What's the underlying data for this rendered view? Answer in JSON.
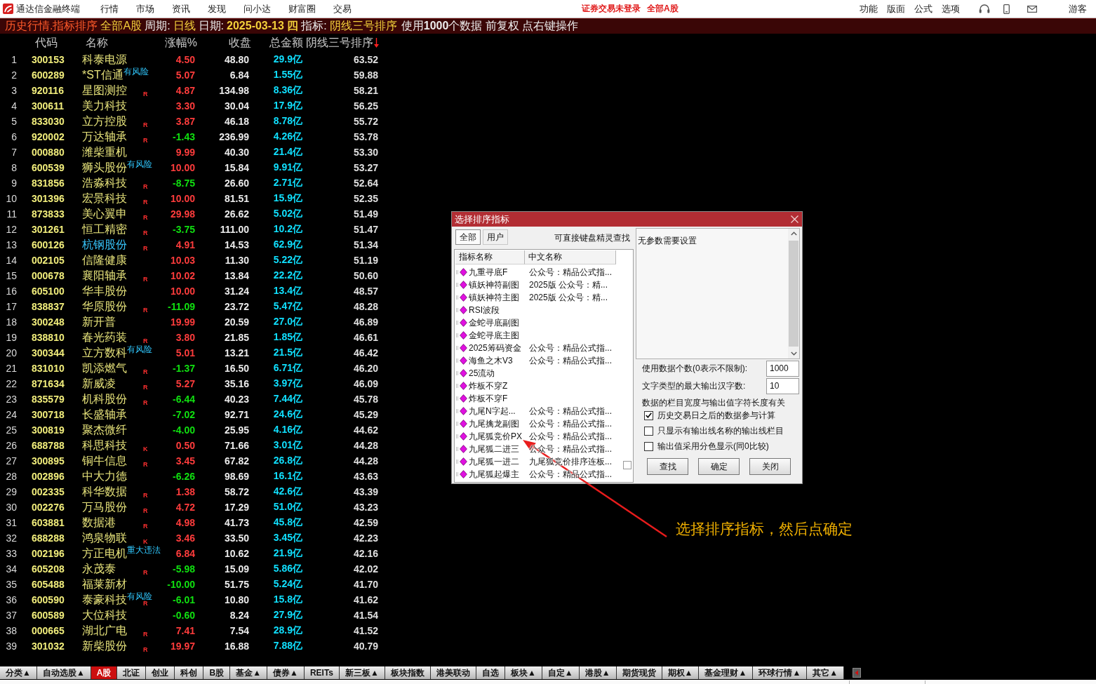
{
  "app_bar": {
    "title": "通达信金融终端",
    "menu": [
      "行情",
      "市场",
      "资讯",
      "发现",
      "问小达",
      "财富圈",
      "交易"
    ],
    "status": [
      "证券交易未登录",
      "全部A股"
    ],
    "tools": [
      "功能",
      "版面",
      "公式",
      "选项"
    ],
    "user": "游客"
  },
  "info_bar": [
    {
      "text": "历史行情.指标排序",
      "kind": "title"
    },
    {
      "text": "全部A股",
      "kind": "value"
    },
    {
      "text": "周期:",
      "kind": "label"
    },
    {
      "text": "日线",
      "kind": "value"
    },
    {
      "text": "日期:",
      "kind": "label"
    },
    {
      "text": "2025-03-13 四",
      "kind": "date"
    },
    {
      "text": "指标:",
      "kind": "label"
    },
    {
      "text": "阴线三号排序",
      "kind": "value"
    },
    {
      "text": "使用**1000**个数据 前复权 点右键操作",
      "kind": "label"
    }
  ],
  "table": {
    "columns": [
      {
        "label": "代码",
        "sorted": false
      },
      {
        "label": "名称",
        "sorted": false
      },
      {
        "label": "涨幅%",
        "sorted": false
      },
      {
        "label": "收盘",
        "sorted": false
      },
      {
        "label": "总金额",
        "sorted": false
      },
      {
        "label": "阴线三号排序",
        "sorted": true
      }
    ],
    "rows": [
      {
        "no": "1",
        "code": "300153",
        "name": "科泰电源",
        "change": "4.50",
        "rising": true,
        "close": "48.80",
        "amount": "29.9亿",
        "rank": "63.52",
        "highlighted": false
      },
      {
        "no": "2",
        "code": "600289",
        "name": "*ST信通",
        "note": "有风险",
        "change": "5.07",
        "rising": true,
        "close": "6.84",
        "amount": "1.55亿",
        "rank": "59.88",
        "highlighted": false
      },
      {
        "no": "3",
        "code": "920116",
        "name": "星图测控",
        "tag": "R",
        "change": "4.87",
        "rising": true,
        "close": "134.98",
        "amount": "8.36亿",
        "rank": "58.21",
        "highlighted": false
      },
      {
        "no": "4",
        "code": "300611",
        "name": "美力科技",
        "change": "3.30",
        "rising": true,
        "close": "30.04",
        "amount": "17.9亿",
        "rank": "56.25",
        "highlighted": false
      },
      {
        "no": "5",
        "code": "833030",
        "name": "立方控股",
        "tag": "R",
        "change": "3.87",
        "rising": true,
        "close": "46.18",
        "amount": "8.78亿",
        "rank": "55.72",
        "highlighted": false
      },
      {
        "no": "6",
        "code": "920002",
        "name": "万达轴承",
        "tag": "R",
        "change": "-1.43",
        "rising": false,
        "close": "236.99",
        "amount": "4.26亿",
        "rank": "53.78",
        "highlighted": false
      },
      {
        "no": "7",
        "code": "000880",
        "name": "潍柴重机",
        "change": "9.99",
        "rising": true,
        "close": "40.30",
        "amount": "21.4亿",
        "rank": "53.30",
        "highlighted": false
      },
      {
        "no": "8",
        "code": "600539",
        "name": "狮头股份",
        "note": "有风险",
        "change": "10.00",
        "rising": true,
        "close": "15.84",
        "amount": "9.91亿",
        "rank": "53.27",
        "highlighted": false
      },
      {
        "no": "9",
        "code": "831856",
        "name": "浩淼科技",
        "tag": "R",
        "change": "-8.75",
        "rising": false,
        "close": "26.60",
        "amount": "2.71亿",
        "rank": "52.64",
        "highlighted": false
      },
      {
        "no": "10",
        "code": "301396",
        "name": "宏景科技",
        "tag": "R",
        "change": "10.00",
        "rising": true,
        "close": "81.51",
        "amount": "15.9亿",
        "rank": "52.35",
        "highlighted": false
      },
      {
        "no": "11",
        "code": "873833",
        "name": "美心翼申",
        "tag": "R",
        "change": "29.98",
        "rising": true,
        "close": "26.62",
        "amount": "5.02亿",
        "rank": "51.49",
        "highlighted": false
      },
      {
        "no": "12",
        "code": "301261",
        "name": "恒工精密",
        "tag": "R",
        "change": "-3.75",
        "rising": false,
        "close": "111.00",
        "amount": "10.2亿",
        "rank": "51.47",
        "highlighted": false
      },
      {
        "no": "13",
        "code": "600126",
        "name": "杭钢股份",
        "tag": "R",
        "change": "4.91",
        "rising": true,
        "close": "14.53",
        "amount": "62.9亿",
        "rank": "51.34",
        "highlighted": true
      },
      {
        "no": "14",
        "code": "002105",
        "name": "信隆健康",
        "change": "10.03",
        "rising": true,
        "close": "11.30",
        "amount": "5.22亿",
        "rank": "51.19",
        "highlighted": false
      },
      {
        "no": "15",
        "code": "000678",
        "name": "襄阳轴承",
        "tag": "R",
        "change": "10.02",
        "rising": true,
        "close": "13.84",
        "amount": "22.2亿",
        "rank": "50.60",
        "highlighted": false
      },
      {
        "no": "16",
        "code": "605100",
        "name": "华丰股份",
        "change": "10.00",
        "rising": true,
        "close": "31.24",
        "amount": "13.4亿",
        "rank": "48.57",
        "highlighted": false
      },
      {
        "no": "17",
        "code": "838837",
        "name": "华原股份",
        "tag": "R",
        "change": "-11.09",
        "rising": false,
        "close": "23.72",
        "amount": "5.47亿",
        "rank": "48.28",
        "highlighted": false
      },
      {
        "no": "18",
        "code": "300248",
        "name": "新开普",
        "change": "19.99",
        "rising": true,
        "close": "20.59",
        "amount": "27.0亿",
        "rank": "46.89",
        "highlighted": false
      },
      {
        "no": "19",
        "code": "838810",
        "name": "春光药装",
        "tag": "R",
        "change": "3.80",
        "rising": true,
        "close": "21.85",
        "amount": "1.85亿",
        "rank": "46.61",
        "highlighted": false
      },
      {
        "no": "20",
        "code": "300344",
        "name": "立方数科",
        "note": "有风险",
        "change": "5.01",
        "rising": true,
        "close": "13.21",
        "amount": "21.5亿",
        "rank": "46.42",
        "highlighted": false
      },
      {
        "no": "21",
        "code": "831010",
        "name": "凯添燃气",
        "tag": "R",
        "change": "-1.37",
        "rising": false,
        "close": "16.50",
        "amount": "6.71亿",
        "rank": "46.20",
        "highlighted": false
      },
      {
        "no": "22",
        "code": "871634",
        "name": "新威凌",
        "tag": "R",
        "change": "5.27",
        "rising": true,
        "close": "35.16",
        "amount": "3.97亿",
        "rank": "46.09",
        "highlighted": false
      },
      {
        "no": "23",
        "code": "835579",
        "name": "机科股份",
        "tag": "R",
        "change": "-6.44",
        "rising": false,
        "close": "40.23",
        "amount": "7.44亿",
        "rank": "45.78",
        "highlighted": false
      },
      {
        "no": "24",
        "code": "300718",
        "name": "长盛轴承",
        "change": "-7.02",
        "rising": false,
        "close": "92.71",
        "amount": "24.6亿",
        "rank": "45.29",
        "highlighted": false
      },
      {
        "no": "25",
        "code": "300819",
        "name": "聚杰微纤",
        "change": "-4.00",
        "rising": false,
        "close": "25.95",
        "amount": "4.16亿",
        "rank": "44.62",
        "highlighted": false
      },
      {
        "no": "26",
        "code": "688788",
        "name": "科思科技",
        "tag": "K",
        "change": "0.50",
        "rising": true,
        "close": "71.66",
        "amount": "3.01亿",
        "rank": "44.28",
        "highlighted": false
      },
      {
        "no": "27",
        "code": "300895",
        "name": "铜牛信息",
        "tag": "R",
        "change": "3.45",
        "rising": true,
        "close": "67.82",
        "amount": "26.8亿",
        "rank": "44.28",
        "highlighted": false
      },
      {
        "no": "28",
        "code": "002896",
        "name": "中大力德",
        "change": "-6.26",
        "rising": false,
        "close": "98.69",
        "amount": "16.1亿",
        "rank": "43.63",
        "highlighted": false
      },
      {
        "no": "29",
        "code": "002335",
        "name": "科华数据",
        "tag": "R",
        "change": "1.38",
        "rising": true,
        "close": "58.72",
        "amount": "42.6亿",
        "rank": "43.39",
        "highlighted": false
      },
      {
        "no": "30",
        "code": "002276",
        "name": "万马股份",
        "tag": "R",
        "change": "4.72",
        "rising": true,
        "close": "17.29",
        "amount": "51.0亿",
        "rank": "43.23",
        "highlighted": false
      },
      {
        "no": "31",
        "code": "603881",
        "name": "数据港",
        "tag": "R",
        "change": "4.98",
        "rising": true,
        "close": "41.73",
        "amount": "45.8亿",
        "rank": "42.59",
        "highlighted": false
      },
      {
        "no": "32",
        "code": "688288",
        "name": "鸿泉物联",
        "tag": "K",
        "change": "3.46",
        "rising": true,
        "close": "33.50",
        "amount": "3.45亿",
        "rank": "42.23",
        "highlighted": false
      },
      {
        "no": "33",
        "code": "002196",
        "name": "方正电机",
        "note": "重大违法",
        "change": "6.84",
        "rising": true,
        "close": "10.62",
        "amount": "21.9亿",
        "rank": "42.16",
        "highlighted": false
      },
      {
        "no": "34",
        "code": "605208",
        "name": "永茂泰",
        "tag": "R",
        "change": "-5.98",
        "rising": false,
        "close": "15.09",
        "amount": "5.86亿",
        "rank": "42.02",
        "highlighted": false
      },
      {
        "no": "35",
        "code": "605488",
        "name": "福莱新材",
        "change": "-10.00",
        "rising": false,
        "close": "51.75",
        "amount": "5.24亿",
        "rank": "41.70",
        "highlighted": false
      },
      {
        "no": "36",
        "code": "600590",
        "name": "泰豪科技",
        "note": "有风险",
        "tag": "R",
        "change": "-6.01",
        "rising": false,
        "close": "10.80",
        "amount": "15.8亿",
        "rank": "41.62",
        "highlighted": false
      },
      {
        "no": "37",
        "code": "600589",
        "name": "大位科技",
        "change": "-0.60",
        "rising": false,
        "close": "8.24",
        "amount": "27.9亿",
        "rank": "41.54",
        "highlighted": false
      },
      {
        "no": "38",
        "code": "000665",
        "name": "湖北广电",
        "tag": "R",
        "change": "7.41",
        "rising": true,
        "close": "7.54",
        "amount": "28.9亿",
        "rank": "41.52",
        "highlighted": false
      },
      {
        "no": "39",
        "code": "301032",
        "name": "新柴股份",
        "tag": "R",
        "change": "19.97",
        "rising": true,
        "close": "16.88",
        "amount": "7.88亿",
        "rank": "40.79",
        "highlighted": false
      }
    ]
  },
  "dialog": {
    "title": "选择排序指标",
    "tabs": [
      {
        "label": "全部",
        "selected": true
      },
      {
        "label": "用户",
        "selected": false
      }
    ],
    "hint": "可直接键盘精灵查找",
    "list": {
      "columns": [
        "指标名称",
        "中文名称"
      ],
      "items": [
        {
          "name": "九重寻底F",
          "description": "公众号：精品公式指...",
          "selected": false
        },
        {
          "name": "镇妖神符副图",
          "description": "2025版 公众号：精...",
          "selected": false
        },
        {
          "name": "镇妖神符主图",
          "description": "2025版 公众号：精...",
          "selected": false
        },
        {
          "name": "RSI波段",
          "selected": false
        },
        {
          "name": "金蛇寻底副图",
          "selected": false
        },
        {
          "name": "金蛇寻底主图",
          "selected": false
        },
        {
          "name": "2025筹码资金",
          "description": "公众号：精品公式指...",
          "selected": false
        },
        {
          "name": "海鱼之木V3",
          "description": "公众号：精品公式指...",
          "selected": false
        },
        {
          "name": "25流动",
          "selected": false
        },
        {
          "name": "炸板不穿Z",
          "selected": false
        },
        {
          "name": "炸板不穿F",
          "selected": false
        },
        {
          "name": "九尾N字起...",
          "description": "公众号：精品公式指...",
          "selected": false
        },
        {
          "name": "九尾擒龙副图",
          "description": "公众号：精品公式指...",
          "selected": false
        },
        {
          "name": "九尾狐竞价PX",
          "description": "公众号：精品公式指...",
          "selected": false
        },
        {
          "name": "九尾狐二进三",
          "description": "公众号：精品公式指...",
          "selected": false
        },
        {
          "name": "九尾狐一进二",
          "description": "九尾狐竞价排序连板...",
          "selected": false
        },
        {
          "name": "九尾狐起爆主",
          "description": "公众号：精品公式指...",
          "selected": false
        }
      ]
    },
    "params_text": "无参数需要设置",
    "fields": [
      {
        "label": "使用数据个数(0表示不限制):",
        "value": "1000"
      },
      {
        "label": "文字类型的最大输出汉字数:",
        "value": "10"
      }
    ],
    "note": "数据的栏目宽度与输出值字符长度有关",
    "checkboxes": [
      {
        "label": "历史交易日之后的数据参与计算",
        "checked": true
      },
      {
        "label": "只显示有输出线名称的输出线栏目",
        "checked": false
      },
      {
        "label": "输出值采用分色显示(同0比较)",
        "checked": false
      }
    ],
    "buttons": [
      "查找",
      "确定",
      "关闭"
    ]
  },
  "annotation": "选择排序指标，然后点确定",
  "bottom_tabs": [
    {
      "label": "分类▲",
      "selected": false
    },
    {
      "label": "自动选股▲",
      "selected": false
    },
    {
      "label": "A股",
      "selected": true
    },
    {
      "label": "北证",
      "selected": false
    },
    {
      "label": "创业",
      "selected": false
    },
    {
      "label": "科创",
      "selected": false
    },
    {
      "label": "B股",
      "selected": false
    },
    {
      "label": "基金▲",
      "selected": false
    },
    {
      "label": "债券▲",
      "selected": false
    },
    {
      "label": "REITs",
      "selected": false
    },
    {
      "label": "新三板▲",
      "selected": false
    },
    {
      "label": "板块指数",
      "selected": false
    },
    {
      "label": "港美联动",
      "selected": false
    },
    {
      "label": "自选",
      "selected": false
    },
    {
      "label": "板块▲",
      "selected": false
    },
    {
      "label": "自定▲",
      "selected": false
    },
    {
      "label": "港股▲",
      "selected": false
    },
    {
      "label": "期货现货",
      "selected": false
    },
    {
      "label": "期权▲",
      "selected": false
    },
    {
      "label": "基金理财▲",
      "selected": false
    },
    {
      "label": "环球行情▲",
      "selected": false
    },
    {
      "label": "其它▲",
      "selected": false
    }
  ]
}
